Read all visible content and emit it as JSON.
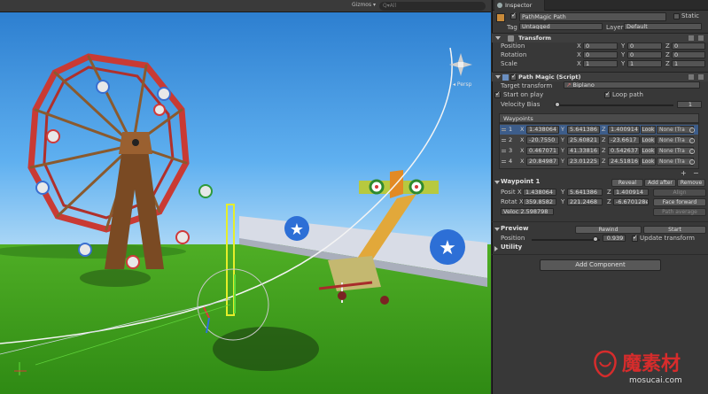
{
  "scene": {
    "gizmos_label": "Gizmos ▾",
    "search_placeholder": "Q▾All",
    "persp_label": "◂ Persp"
  },
  "inspector": {
    "tab_label": "Inspector",
    "object_name": "PathMagic Path",
    "static_label": "Static",
    "tag_label": "Tag",
    "tag_value": "Untagged",
    "layer_label": "Layer",
    "layer_value": "Default",
    "transform": {
      "title": "Transform",
      "rows": [
        {
          "label": "Position",
          "x": "0",
          "y": "0",
          "z": "0"
        },
        {
          "label": "Rotation",
          "x": "0",
          "y": "0",
          "z": "0"
        },
        {
          "label": "Scale",
          "x": "1",
          "y": "1",
          "z": "1"
        }
      ],
      "axis_x": "X",
      "axis_y": "Y",
      "axis_z": "Z"
    },
    "pathmagic": {
      "title": "Path Magic (Script)",
      "target_label": "Target transform",
      "target_value": "Biplano",
      "start_on_play": "Start on play",
      "loop_path": "Loop path",
      "velocity_bias_label": "Velocity Bias",
      "velocity_bias_value": "1",
      "waypoints_label": "Waypoints",
      "look_label": "Look",
      "waypoints": [
        {
          "n": "1",
          "x": "1.438064",
          "y": "5.641386",
          "z": "1.400914",
          "obj": "None (Tra"
        },
        {
          "n": "2",
          "x": "-20.7550",
          "y": "25.60821",
          "z": "-23.6617",
          "obj": "None (Tra"
        },
        {
          "n": "3",
          "x": "0.467071",
          "y": "41.33816",
          "z": "0.542637",
          "obj": "None (Tra"
        },
        {
          "n": "4",
          "x": "20.84987",
          "y": "23.01225",
          "z": "24.51816",
          "obj": "None (Tra"
        }
      ],
      "plus": "+",
      "minus": "−"
    },
    "waypoint1": {
      "title": "Waypoint 1",
      "reveal": "Reveal",
      "add_after": "Add after",
      "remove": "Remove",
      "posit_label": "Posit X",
      "posit_x": "1.438064",
      "posit_y": "5.641386",
      "posit_z": "1.400914",
      "align": "Align",
      "rotat_label": "Rotat X",
      "rotat_x": "359.8582",
      "rotat_y": "221.2468",
      "rotat_z": "-6.670128e",
      "face_forward": "Face forward",
      "velocity_label": "Veloc 2.598798",
      "path_average": "Path average"
    },
    "preview": {
      "title": "Preview",
      "rewind": "Rewind",
      "start": "Start",
      "position_label": "Position",
      "position_value": "0.939",
      "position_fraction": 0.939,
      "update_transform": "Update transform"
    },
    "utility": {
      "title": "Utility"
    },
    "add_component": "Add Component"
  },
  "watermark": {
    "text": "魔素材",
    "sub": "mosucai.com"
  }
}
